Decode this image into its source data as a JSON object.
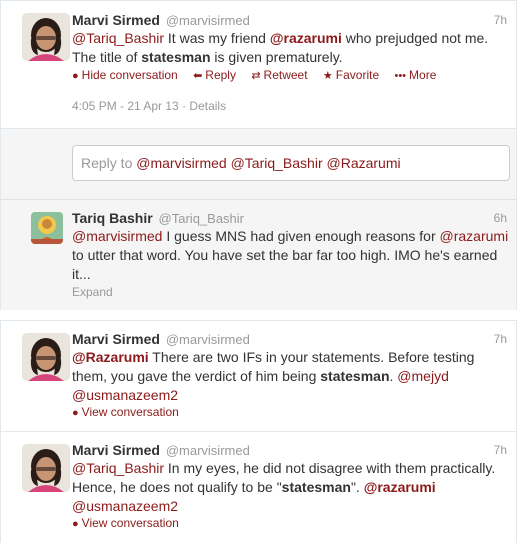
{
  "conversation": {
    "main_tweet": {
      "name": "Marvi Sirmed",
      "handle": "@marvisirmed",
      "time": "7h",
      "text": [
        {
          "t": "mention",
          "v": "@Tariq_Bashir"
        },
        {
          "t": "text",
          "v": " It was my friend "
        },
        {
          "t": "mention_bold",
          "v": "@razarumi"
        },
        {
          "t": "text",
          "v": " who prejudged not me. The title of "
        },
        {
          "t": "bold",
          "v": "statesman"
        },
        {
          "t": "text",
          "v": " is given prematurely."
        }
      ],
      "actions": {
        "hide": "Hide conversation",
        "reply": "Reply",
        "retweet": "Retweet",
        "favorite": "Favorite",
        "more": "More"
      },
      "timestamp": "4:05 PM - 21 Apr 13",
      "details": "Details"
    },
    "reply_box": {
      "prefix": "Reply to ",
      "mentions": "@marvisirmed @Tariq_Bashir @Razarumi"
    },
    "reply_tweet": {
      "name": "Tariq Bashir",
      "handle": "@Tariq_Bashir",
      "time": "6h",
      "text": [
        {
          "t": "mention",
          "v": "@marvisirmed"
        },
        {
          "t": "text",
          "v": " I guess MNS had given enough reasons for "
        },
        {
          "t": "mention",
          "v": "@razarumi"
        },
        {
          "t": "text",
          "v": " to utter that word. You have set the bar far too high. IMO he's earned it..."
        }
      ],
      "expand": "Expand"
    }
  },
  "tweets": [
    {
      "name": "Marvi Sirmed",
      "handle": "@marvisirmed",
      "time": "7h",
      "text": [
        {
          "t": "mention_bold",
          "v": "@Razarumi"
        },
        {
          "t": "text",
          "v": " There are two IFs in your statements. Before testing them, you gave the verdict of him being "
        },
        {
          "t": "bold",
          "v": "statesman"
        },
        {
          "t": "text",
          "v": ". "
        },
        {
          "t": "mention",
          "v": "@mejyd"
        },
        {
          "t": "text",
          "v": " "
        },
        {
          "t": "mention",
          "v": "@usmanazeem2"
        }
      ],
      "view": "View conversation"
    },
    {
      "name": "Marvi Sirmed",
      "handle": "@marvisirmed",
      "time": "7h",
      "text": [
        {
          "t": "mention",
          "v": "@Tariq_Bashir"
        },
        {
          "t": "text",
          "v": " In my eyes, he did not disagree with them practically. Hence, he does not qualify to be \""
        },
        {
          "t": "bold",
          "v": "statesman"
        },
        {
          "t": "text",
          "v": "\". "
        },
        {
          "t": "mention_bold",
          "v": "@razarumi"
        },
        {
          "t": "text",
          "v": " "
        },
        {
          "t": "mention",
          "v": "@usmanazeem2"
        }
      ],
      "view": "View conversation"
    }
  ],
  "icons": {
    "hide": "chat-bubble-icon",
    "reply": "reply-arrow-icon",
    "retweet": "retweet-icon",
    "favorite": "star-icon",
    "more": "more-dots-icon",
    "view": "chat-bubble-icon"
  },
  "colors": {
    "link": "#8b1a1a",
    "muted": "#999999",
    "text": "#333333",
    "expanded_bg": "#f5f5f5"
  }
}
